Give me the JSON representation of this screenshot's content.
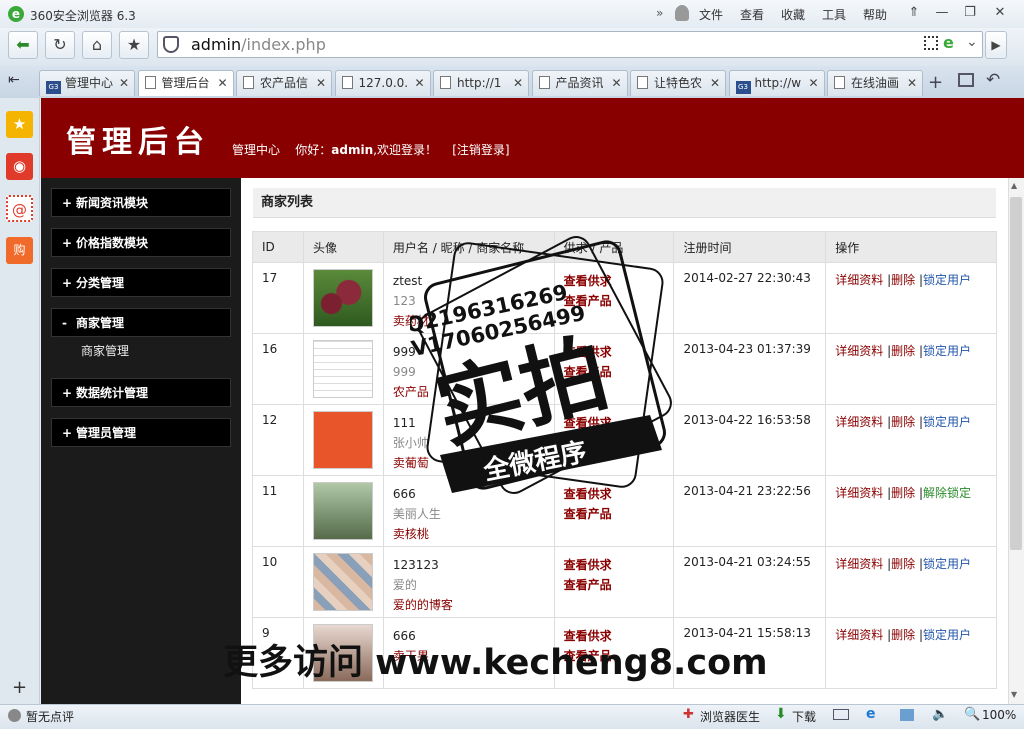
{
  "window": {
    "title": "360安全浏览器 6.3",
    "menus": [
      "文件",
      "查看",
      "收藏",
      "工具",
      "帮助"
    ]
  },
  "address": {
    "host": "admin",
    "path": "/index.php"
  },
  "tabs": [
    {
      "label": "管理中心",
      "icon": "site"
    },
    {
      "label": "管理后台",
      "icon": "doc",
      "active": true
    },
    {
      "label": "农产品信",
      "icon": "doc"
    },
    {
      "label": "127.0.0.",
      "icon": "doc"
    },
    {
      "label": "http://1",
      "icon": "doc"
    },
    {
      "label": "产品资讯",
      "icon": "doc"
    },
    {
      "label": "让特色农",
      "icon": "doc"
    },
    {
      "label": "http://w",
      "icon": "site"
    },
    {
      "label": "在线油画",
      "icon": "doc"
    }
  ],
  "header": {
    "logo": "管理后台",
    "link_center": "管理中心",
    "greeting": "你好：",
    "user": "admin",
    "welcome": ",欢迎登录！",
    "logout": "[注销登录]"
  },
  "nav": [
    {
      "label": "新闻资讯模块",
      "sign": "+"
    },
    {
      "label": "价格指数模块",
      "sign": "+"
    },
    {
      "label": "分类管理",
      "sign": "+"
    },
    {
      "label": "商家管理",
      "sign": "-",
      "sub": "商家管理"
    },
    {
      "label": "数据统计管理",
      "sign": "+"
    },
    {
      "label": "管理员管理",
      "sign": "+"
    }
  ],
  "section_title": "商家列表",
  "columns": [
    "ID",
    "头像",
    "用户名 / 昵称 / 商家名称",
    "供求 / 产品",
    "注册时间",
    "操作"
  ],
  "rows": [
    {
      "id": "17",
      "user": "ztest",
      "nick": "123",
      "shop": "卖药材",
      "time": "2014-02-27 22:30:43",
      "lock": "锁定用户"
    },
    {
      "id": "16",
      "user": "999",
      "nick": "999",
      "shop": "农产品",
      "time": "2013-04-23 01:37:39",
      "lock": "锁定用户"
    },
    {
      "id": "12",
      "user": "111",
      "nick": "张小帅",
      "shop": "卖葡萄",
      "time": "2013-04-22 16:53:58",
      "lock": "锁定用户"
    },
    {
      "id": "11",
      "user": "666",
      "nick": "美丽人生",
      "shop": "卖核桃",
      "time": "2013-04-21 23:22:56",
      "lock": "解除锁定"
    },
    {
      "id": "10",
      "user": "123123",
      "nick": "爱的",
      "shop": "爱的的博客",
      "time": "2013-04-21 03:24:55",
      "lock": "锁定用户"
    },
    {
      "id": "9",
      "user": "666",
      "nick": "",
      "shop": "卖干果",
      "time": "2013-04-21 15:58:13",
      "lock": "锁定用户"
    }
  ],
  "supply_label": "查看供求",
  "product_label": "查看产品",
  "detail_label": "详细资料",
  "delete_label": "删除",
  "status": {
    "comment": "暂无点评",
    "doctor": "浏览器医生",
    "download": "下载",
    "zoom": "100%"
  },
  "watermark": {
    "qq": "Q2196316269",
    "v": "V17060256499",
    "big": "实拍",
    "band": "全微程序",
    "site": "更多访问 www.kecheng8.com"
  }
}
